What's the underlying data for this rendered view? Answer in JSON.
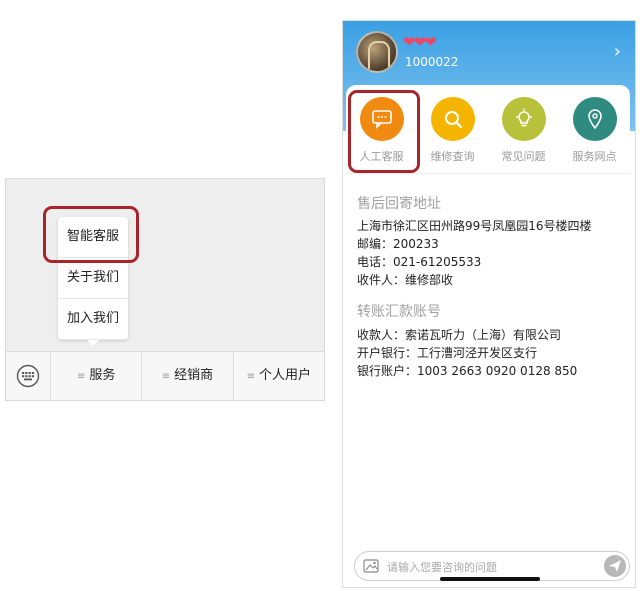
{
  "left": {
    "popup_items": [
      "智能客服",
      "关于我们",
      "加入我们"
    ],
    "menu_items": [
      "服务",
      "经销商",
      "个人用户"
    ]
  },
  "right": {
    "user_id": "1000022",
    "icons": [
      {
        "label": "人工客服",
        "icon": "chat-bubble-icon",
        "color": "#f08a10"
      },
      {
        "label": "维修查询",
        "icon": "search-icon",
        "color": "#f4b400"
      },
      {
        "label": "常见问题",
        "icon": "lightbulb-icon",
        "color": "#b8c13a"
      },
      {
        "label": "服务网点",
        "icon": "location-pin-icon",
        "color": "#2f8a7f"
      }
    ],
    "section1_title": "售后回寄地址",
    "address_lines": [
      "上海市徐汇区田州路99号凤凰园16号楼四楼",
      "邮编：200233",
      "电话：021-61205533",
      "收件人：维修部收"
    ],
    "section2_title": "转账汇款账号",
    "bank_lines": [
      "收款人：索诺瓦听力（上海）有限公司",
      "开户银行：工行漕河泾开发区支行",
      "银行账户：1003 2663 0920 0128 850"
    ],
    "input_placeholder": "请输入您要咨询的问题",
    "highlight_color": "#a8252a"
  }
}
